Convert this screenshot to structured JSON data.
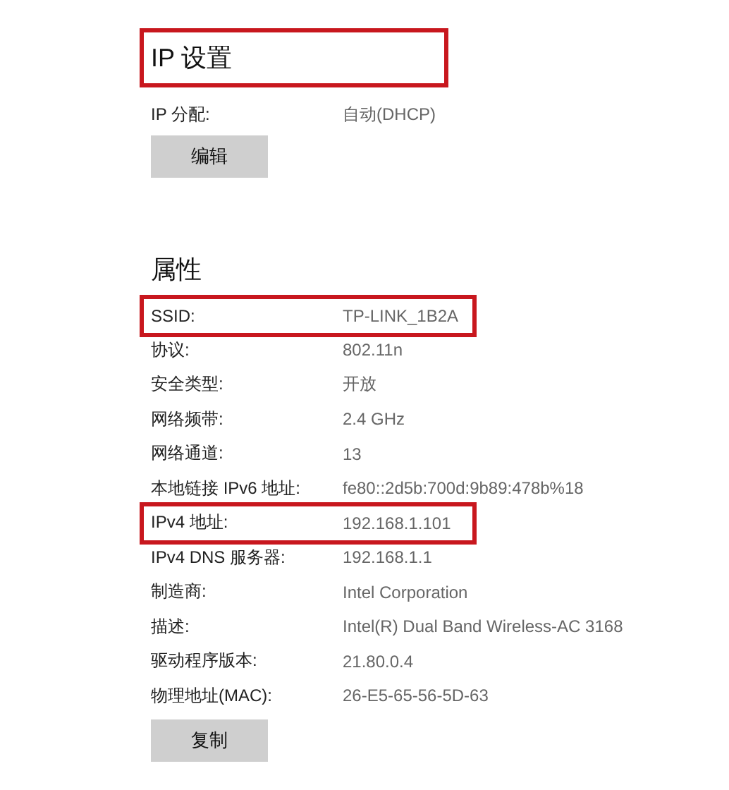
{
  "ip_settings": {
    "title": "IP 设置",
    "highlighted": true,
    "label": "IP 分配:",
    "value": "自动(DHCP)",
    "button": "编辑"
  },
  "properties": {
    "title": "属性",
    "highlighted": false,
    "rows": [
      {
        "label": "SSID:",
        "value": "TP-LINK_1B2A",
        "highlighted": true
      },
      {
        "label": "协议:",
        "value": "802.11n",
        "highlighted": false
      },
      {
        "label": "安全类型:",
        "value": "开放",
        "highlighted": false
      },
      {
        "label": "网络频带:",
        "value": "2.4 GHz",
        "highlighted": false
      },
      {
        "label": "网络通道:",
        "value": "13",
        "highlighted": false
      },
      {
        "label": "本地链接 IPv6 地址:",
        "value": "fe80::2d5b:700d:9b89:478b%18",
        "highlighted": false
      },
      {
        "label": "IPv4 地址:",
        "value": "192.168.1.101",
        "highlighted": true
      },
      {
        "label": "IPv4 DNS 服务器:",
        "value": "192.168.1.1",
        "highlighted": false
      },
      {
        "label": "制造商:",
        "value": "Intel Corporation",
        "highlighted": false
      },
      {
        "label": "描述:",
        "value": "Intel(R) Dual Band Wireless-AC 3168",
        "highlighted": false
      },
      {
        "label": "驱动程序版本:",
        "value": "21.80.0.4",
        "highlighted": false
      },
      {
        "label": "物理地址(MAC):",
        "value": "26-E5-65-56-5D-63",
        "highlighted": false
      }
    ],
    "button": "复制"
  }
}
